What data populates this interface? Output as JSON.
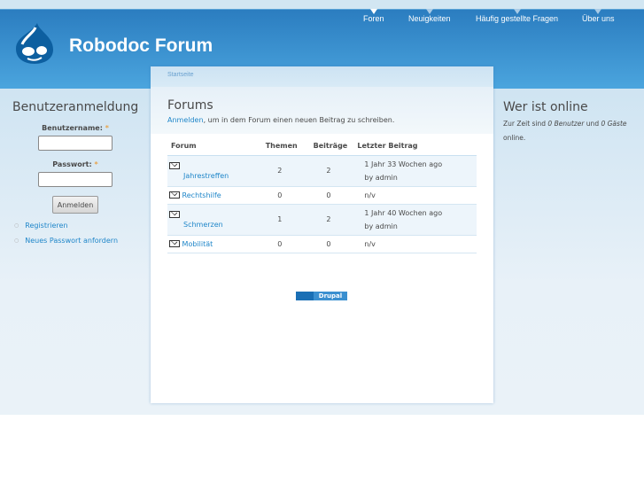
{
  "site": {
    "name": "Robodoc Forum"
  },
  "nav": [
    {
      "label": "Foren"
    },
    {
      "label": "Neuigkeiten"
    },
    {
      "label": "Häufig gestellte Fragen"
    },
    {
      "label": "Über uns"
    }
  ],
  "breadcrumb": "Startseite",
  "main": {
    "title": "Forums",
    "login_link": "Anmelden",
    "login_text": ", um in dem Forum einen neuen Beitrag zu schreiben.",
    "columns": [
      "Forum",
      "Themen",
      "Beiträge",
      "Letzter Beitrag"
    ],
    "rows": [
      {
        "name": "Jahrestreffen",
        "topics": "2",
        "posts": "2",
        "last": "1 Jahr 33 Wochen ago",
        "by": "by admin"
      },
      {
        "name": "Rechtshilfe",
        "topics": "0",
        "posts": "0",
        "last": "n/v",
        "by": ""
      },
      {
        "name": "Schmerzen",
        "topics": "1",
        "posts": "2",
        "last": "1 Jahr 40 Wochen ago",
        "by": "by admin"
      },
      {
        "name": "Mobilität",
        "topics": "0",
        "posts": "0",
        "last": "n/v",
        "by": ""
      }
    ],
    "badge": "Drupal"
  },
  "login": {
    "title": "Benutzeranmeldung",
    "username_label": "Benutzername:",
    "password_label": "Passwort:",
    "required": "*",
    "username_value": "",
    "password_value": "",
    "button": "Anmelden",
    "links": [
      "Registrieren",
      "Neues Passwort anfordern"
    ]
  },
  "online": {
    "title": "Wer ist online",
    "t1": "Zur Zeit sind ",
    "users": "0 Benutzer",
    "t2": " und ",
    "guests": "0 Gäste",
    "t3": " online."
  }
}
